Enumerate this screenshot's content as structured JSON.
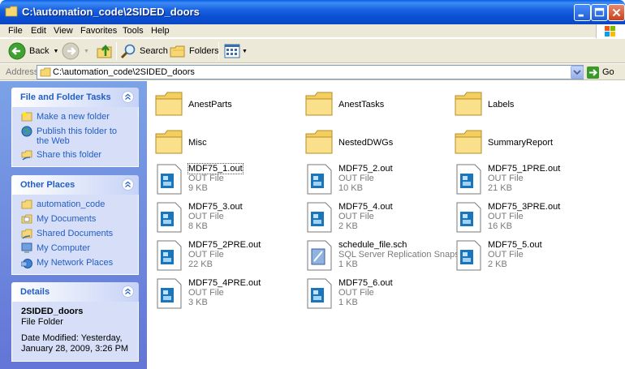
{
  "window": {
    "title": "C:\\automation_code\\2SIDED_doors"
  },
  "menu": [
    "File",
    "Edit",
    "View",
    "Favorites",
    "Tools",
    "Help"
  ],
  "toolbar": {
    "back": "Back",
    "search": "Search",
    "folders": "Folders"
  },
  "address": {
    "label": "Address",
    "path": "C:\\automation_code\\2SIDED_doors",
    "go": "Go"
  },
  "tasks": {
    "title": "File and Folder Tasks",
    "items": [
      "Make a new folder",
      "Publish this folder to the Web",
      "Share this folder"
    ]
  },
  "other_places": {
    "title": "Other Places",
    "items": [
      "automation_code",
      "My Documents",
      "Shared Documents",
      "My Computer",
      "My Network Places"
    ]
  },
  "details": {
    "title": "Details",
    "name": "2SIDED_doors",
    "kind": "File Folder",
    "modified_line1": "Date Modified: Yesterday,",
    "modified_line2": "January 28, 2009, 3:26 PM"
  },
  "files": [
    {
      "name": "AnestParts",
      "kind": "folder"
    },
    {
      "name": "AnestTasks",
      "kind": "folder"
    },
    {
      "name": "Labels",
      "kind": "folder"
    },
    {
      "name": "Misc",
      "kind": "folder"
    },
    {
      "name": "NestedDWGs",
      "kind": "folder"
    },
    {
      "name": "SummaryReport",
      "kind": "folder"
    },
    {
      "name": "MDF75_1.out",
      "type": "OUT File",
      "size": "9 KB",
      "kind": "out"
    },
    {
      "name": "MDF75_2.out",
      "type": "OUT File",
      "size": "10 KB",
      "kind": "out"
    },
    {
      "name": "MDF75_1PRE.out",
      "type": "OUT File",
      "size": "21 KB",
      "kind": "out"
    },
    {
      "name": "MDF75_3.out",
      "type": "OUT File",
      "size": "8 KB",
      "kind": "out"
    },
    {
      "name": "MDF75_4.out",
      "type": "OUT File",
      "size": "2 KB",
      "kind": "out"
    },
    {
      "name": "MDF75_3PRE.out",
      "type": "OUT File",
      "size": "16 KB",
      "kind": "out"
    },
    {
      "name": "MDF75_2PRE.out",
      "type": "OUT File",
      "size": "22 KB",
      "kind": "out"
    },
    {
      "name": "schedule_file.sch",
      "type": "SQL Server Replication Snaps...",
      "size": "1 KB",
      "kind": "sch"
    },
    {
      "name": "MDF75_5.out",
      "type": "OUT File",
      "size": "2 KB",
      "kind": "out"
    },
    {
      "name": "MDF75_4PRE.out",
      "type": "OUT File",
      "size": "3 KB",
      "kind": "out"
    },
    {
      "name": "MDF75_6.out",
      "type": "OUT File",
      "size": "1 KB",
      "kind": "out"
    }
  ]
}
